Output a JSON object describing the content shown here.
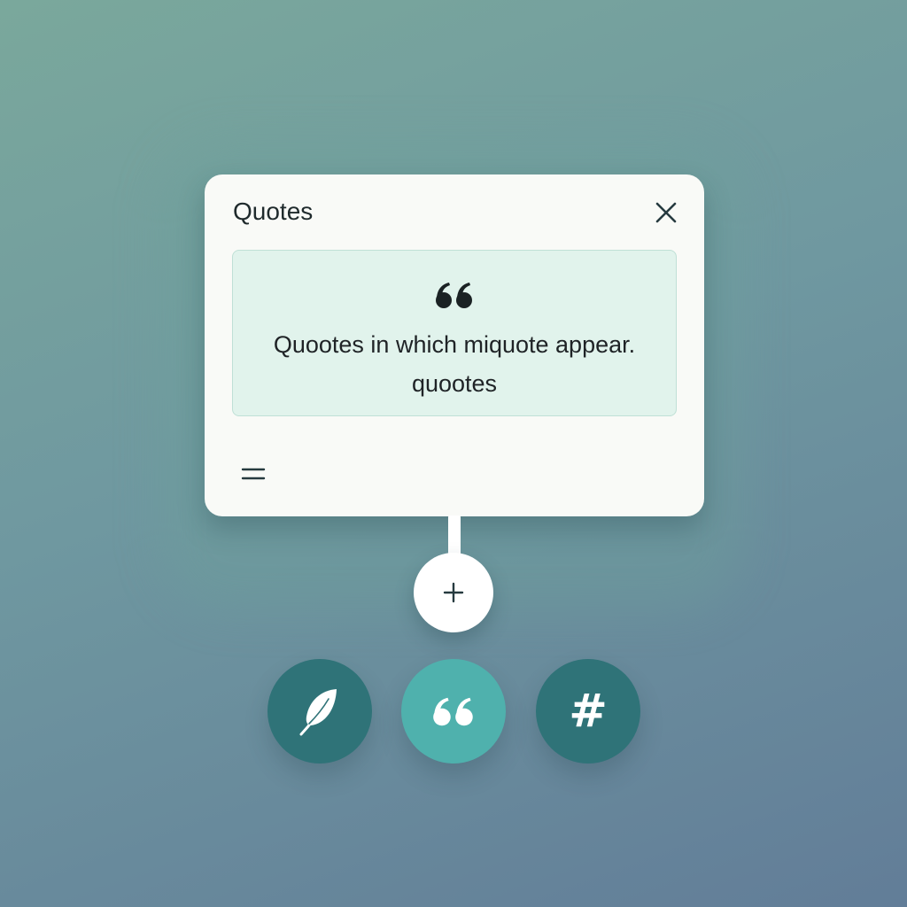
{
  "panel": {
    "title": "Quotes",
    "quote_text": "Quootes in which miquote appear. quootes"
  },
  "icons": {
    "close": "close-icon",
    "quote_mark": "quote-mark-icon",
    "menu": "menu-icon",
    "plus": "plus-icon",
    "feather": "feather-icon",
    "quote": "quote-icon",
    "hash": "hash-icon"
  },
  "action_buttons": {
    "hash_glyph": "#"
  },
  "colors": {
    "accent_dark": "#2f7378",
    "accent_light": "#4fb1ad",
    "quote_card_bg": "#e1f3ec",
    "panel_bg": "#f9faf7"
  }
}
